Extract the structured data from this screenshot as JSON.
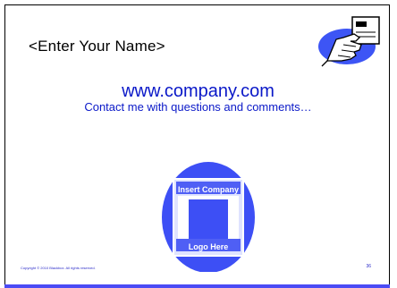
{
  "slide": {
    "name_placeholder": "<Enter Your Name>",
    "website": "www.company.com",
    "contact_line": "Contact me with questions and comments…",
    "logo": {
      "top_text": "Insert Company",
      "bottom_text": "Logo Here"
    },
    "footer": "Copyright © 2010 Blackbox. All rights reserved.",
    "page_number": "36"
  },
  "colors": {
    "accent": "#0a18c8",
    "logo_blue": "#3d4ff5",
    "bar": "#4b4bf5"
  },
  "icons": {
    "clipart": "hand-holding-card-icon"
  }
}
